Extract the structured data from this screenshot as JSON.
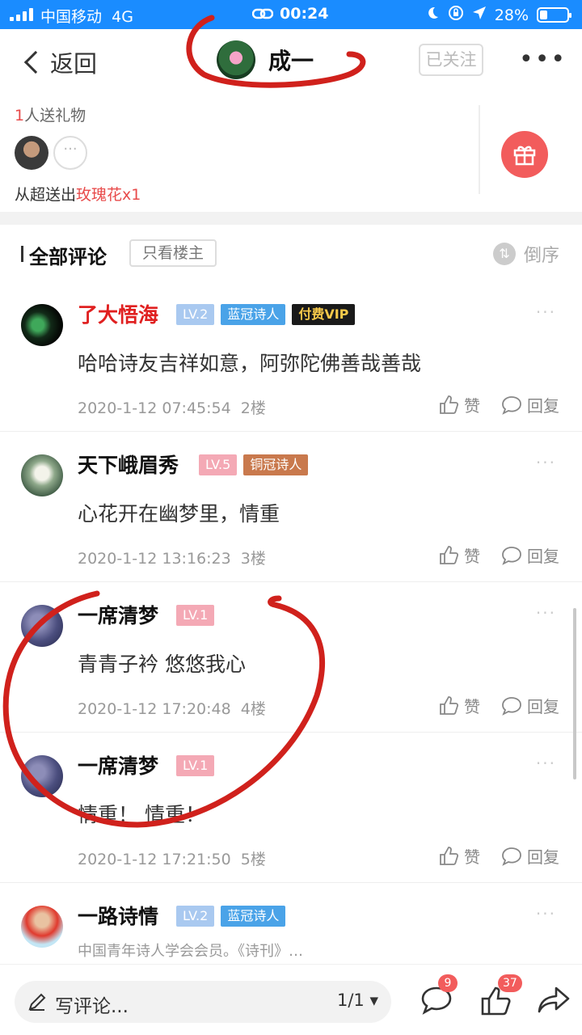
{
  "status_bar": {
    "carrier": "中国移动",
    "network": "4G",
    "time": "00:24",
    "battery": "28%"
  },
  "nav": {
    "back_label": "返回",
    "title": "成一",
    "follow_label": "已关注"
  },
  "gift": {
    "count_num": "1",
    "count_text": "人送礼物",
    "sent_prefix": "从超送出",
    "sent_item": "玫瑰花x1"
  },
  "comments_header": {
    "title": "全部评论",
    "only_host": "只看楼主",
    "sort": "倒序"
  },
  "comments": [
    {
      "user": "了大悟海",
      "level": "LV.2",
      "title_badge": "蓝冠诗人",
      "vip": "付费VIP",
      "text": "哈哈诗友吉祥如意，阿弥陀佛善哉善哉",
      "time": "2020-1-12 07:45:54",
      "floor": "2楼",
      "like": "赞",
      "reply": "回复"
    },
    {
      "user": "天下峨眉秀",
      "level": "LV.5",
      "title_badge": "铜冠诗人",
      "text": "心花开在幽梦里，情重",
      "time": "2020-1-12 13:16:23",
      "floor": "3楼",
      "like": "赞",
      "reply": "回复"
    },
    {
      "user": "一席清梦",
      "level": "LV.1",
      "text": "青青子衿 悠悠我心",
      "time": "2020-1-12 17:20:48",
      "floor": "4楼",
      "like": "赞",
      "reply": "回复"
    },
    {
      "user": "一席清梦",
      "level": "LV.1",
      "text": "情重！ 情重！",
      "time": "2020-1-12 17:21:50",
      "floor": "5楼",
      "like": "赞",
      "reply": "回复"
    },
    {
      "user": "一路诗情",
      "level": "LV.2",
      "title_badge": "蓝冠诗人",
      "bio": "中国青年诗人学会会员。《诗刊》…"
    }
  ],
  "bottom": {
    "compose_placeholder": "写评论...",
    "page": "1/1",
    "comment_count": "9",
    "like_count": "37"
  }
}
